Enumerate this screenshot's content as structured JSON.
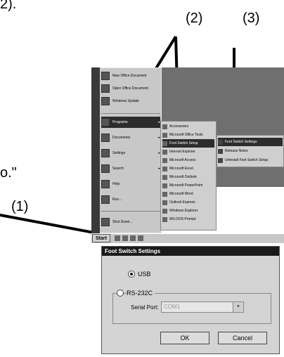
{
  "callouts": {
    "one": "(1)",
    "two": "(2)",
    "three": "(3)"
  },
  "margin_text": {
    "top_fragment": "2).",
    "mid_fragment": "o.\""
  },
  "start_menu": {
    "items": [
      {
        "label": "New Office Document",
        "icon": "document-icon"
      },
      {
        "label": "Open Office Document",
        "icon": "folder-icon"
      },
      {
        "label": "Windows Update",
        "icon": "globe-icon"
      },
      {
        "label": "Programs",
        "icon": "programs-icon",
        "has_submenu": true
      },
      {
        "label": "Documents",
        "icon": "documents-icon",
        "has_submenu": true
      },
      {
        "label": "Settings",
        "icon": "settings-icon",
        "has_submenu": true
      },
      {
        "label": "Search",
        "icon": "search-icon",
        "has_submenu": true
      },
      {
        "label": "Help",
        "icon": "help-icon"
      },
      {
        "label": "Run...",
        "icon": "run-icon"
      },
      {
        "label": "Shut Down...",
        "icon": "shutdown-icon"
      }
    ],
    "selected_index": 3,
    "arrow": "▸"
  },
  "programs_menu": {
    "items": [
      {
        "label": "Accessories"
      },
      {
        "label": "Microsoft Office Tools"
      },
      {
        "label": "Foot Switch Setup"
      },
      {
        "label": "Internet Explorer"
      },
      {
        "label": "Microsoft Access"
      },
      {
        "label": "Microsoft Excel"
      },
      {
        "label": "Microsoft Outlook"
      },
      {
        "label": "Microsoft PowerPoint"
      },
      {
        "label": "Microsoft Word"
      },
      {
        "label": "Outlook Express"
      },
      {
        "label": "Windows Explorer"
      },
      {
        "label": "MS-DOS Prompt"
      }
    ],
    "selected_index": 2
  },
  "submenu": {
    "items": [
      {
        "label": "Foot Switch Settings"
      },
      {
        "label": "Release Notes"
      },
      {
        "label": "Uninstall Foot Switch Setup"
      }
    ],
    "selected_index": 0
  },
  "taskbar": {
    "start_label": "Start"
  },
  "dialog": {
    "title": "Foot Switch Settings",
    "option_usb": "USB",
    "option_rs232c": "RS-232C",
    "usb_selected": true,
    "serial_port_label": "Serial Port:",
    "serial_port_value": "COM1",
    "ok_label": "OK",
    "cancel_label": "Cancel"
  }
}
